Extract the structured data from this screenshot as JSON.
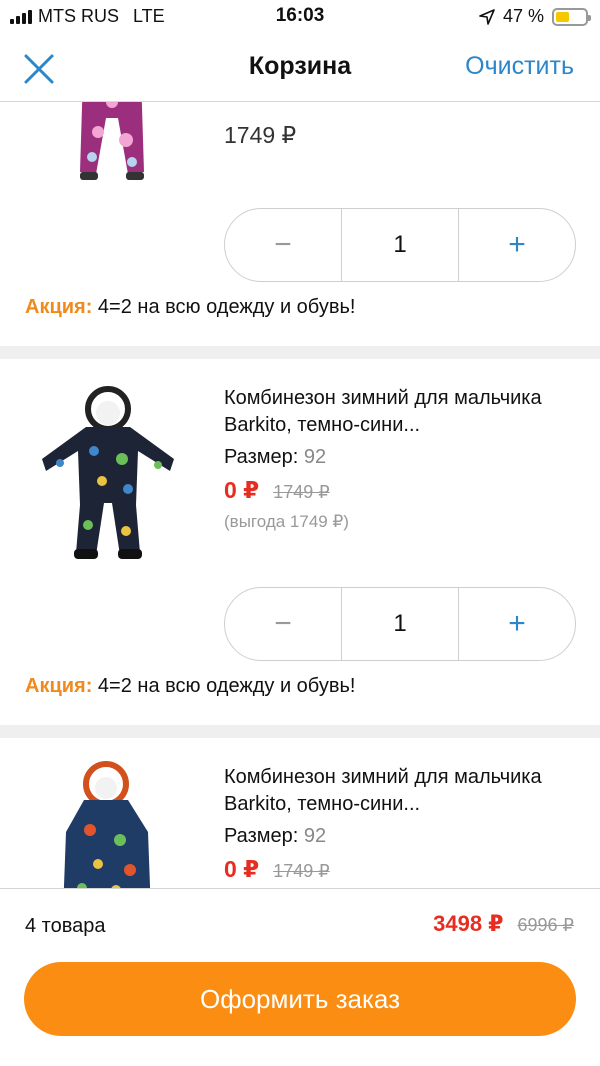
{
  "status_bar": {
    "carrier": "MTS RUS",
    "network": "LTE",
    "time": "16:03",
    "battery": "47 %"
  },
  "nav": {
    "title": "Корзина",
    "action": "Очистить"
  },
  "items": [
    {
      "price": "1749 ₽",
      "quantity": "1",
      "promo_label": "Акция:",
      "promo_text": " 4=2 на всю одежду и обувь!"
    },
    {
      "title": "Комбинезон зимний для мальчика Barkito, темно-сини...",
      "size_label": "Размер:",
      "size_value": "92",
      "price_new": "0 ₽",
      "price_old": "1749 ₽",
      "savings": "(выгода 1749 ₽)",
      "quantity": "1",
      "promo_label": "Акция:",
      "promo_text": " 4=2 на всю одежду и обувь!"
    },
    {
      "title": "Комбинезон зимний для мальчика Barkito, темно-сини...",
      "size_label": "Размер:",
      "size_value": "92",
      "price_new": "0 ₽",
      "price_old": "1749 ₽"
    }
  ],
  "qty_controls": {
    "minus": "−",
    "plus": "+"
  },
  "footer": {
    "count": "4 товара",
    "total_new": "3498 ₽",
    "total_old": "6996 ₽",
    "checkout": "Оформить заказ"
  },
  "colors": {
    "accent_blue": "#2b87c9",
    "price_red": "#e62d22",
    "promo_orange": "#f08a1c",
    "checkout_orange": "#fb8d12"
  }
}
